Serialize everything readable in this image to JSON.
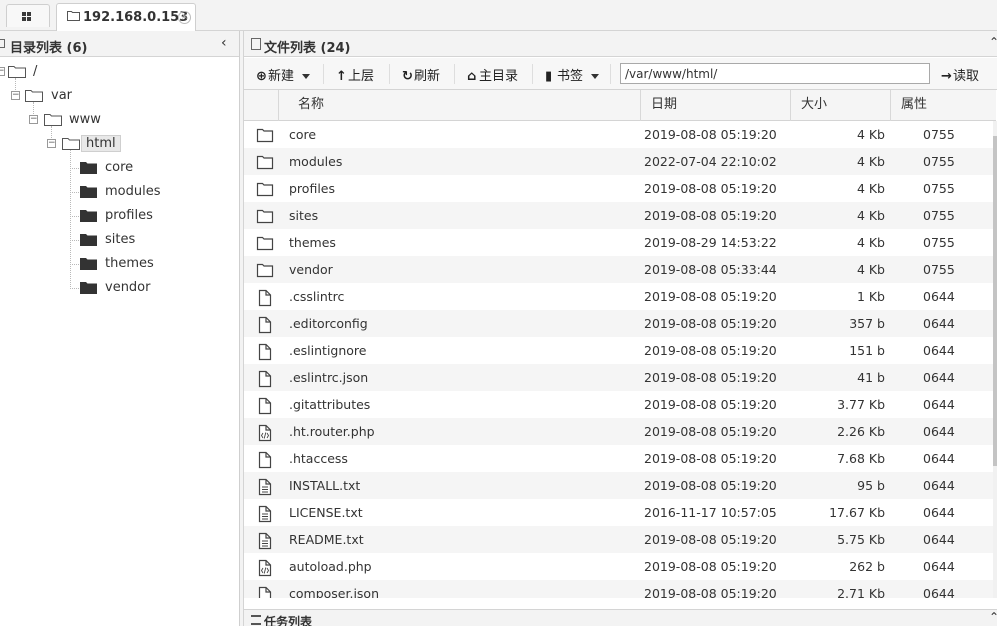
{
  "tabs": {
    "host_label": "192.168.0.153",
    "close_glyph": "⊗"
  },
  "tree": {
    "header": "目录列表 (6)",
    "root": "/",
    "var": "var",
    "www": "www",
    "html": "html",
    "children": [
      "core",
      "modules",
      "profiles",
      "sites",
      "themes",
      "vendor"
    ]
  },
  "files": {
    "header": "文件列表 (24)",
    "toolbar": {
      "new": "新建",
      "up": "上层",
      "refresh": "刷新",
      "home": "主目录",
      "bookmark": "书签",
      "path": "/var/www/html/",
      "read": "读取"
    },
    "columns": [
      "名称",
      "日期",
      "大小",
      "属性"
    ],
    "rows": [
      {
        "type": "folder",
        "name": "core",
        "date": "2019-08-08 05:19:20",
        "size": "4 Kb",
        "attr": "0755"
      },
      {
        "type": "folder",
        "name": "modules",
        "date": "2022-07-04 22:10:02",
        "size": "4 Kb",
        "attr": "0755"
      },
      {
        "type": "folder",
        "name": "profiles",
        "date": "2019-08-08 05:19:20",
        "size": "4 Kb",
        "attr": "0755"
      },
      {
        "type": "folder",
        "name": "sites",
        "date": "2019-08-08 05:19:20",
        "size": "4 Kb",
        "attr": "0755"
      },
      {
        "type": "folder",
        "name": "themes",
        "date": "2019-08-29 14:53:22",
        "size": "4 Kb",
        "attr": "0755"
      },
      {
        "type": "folder",
        "name": "vendor",
        "date": "2019-08-08 05:33:44",
        "size": "4 Kb",
        "attr": "0755"
      },
      {
        "type": "file",
        "name": ".csslintrc",
        "date": "2019-08-08 05:19:20",
        "size": "1 Kb",
        "attr": "0644"
      },
      {
        "type": "file",
        "name": ".editorconfig",
        "date": "2019-08-08 05:19:20",
        "size": "357 b",
        "attr": "0644"
      },
      {
        "type": "file",
        "name": ".eslintignore",
        "date": "2019-08-08 05:19:20",
        "size": "151 b",
        "attr": "0644"
      },
      {
        "type": "file",
        "name": ".eslintrc.json",
        "date": "2019-08-08 05:19:20",
        "size": "41 b",
        "attr": "0644"
      },
      {
        "type": "file",
        "name": ".gitattributes",
        "date": "2019-08-08 05:19:20",
        "size": "3.77 Kb",
        "attr": "0644"
      },
      {
        "type": "code",
        "name": ".ht.router.php",
        "date": "2019-08-08 05:19:20",
        "size": "2.26 Kb",
        "attr": "0644"
      },
      {
        "type": "file",
        "name": ".htaccess",
        "date": "2019-08-08 05:19:20",
        "size": "7.68 Kb",
        "attr": "0644"
      },
      {
        "type": "text",
        "name": "INSTALL.txt",
        "date": "2019-08-08 05:19:20",
        "size": "95 b",
        "attr": "0644"
      },
      {
        "type": "text",
        "name": "LICENSE.txt",
        "date": "2016-11-17 10:57:05",
        "size": "17.67 Kb",
        "attr": "0644"
      },
      {
        "type": "text",
        "name": "README.txt",
        "date": "2019-08-08 05:19:20",
        "size": "5.75 Kb",
        "attr": "0644"
      },
      {
        "type": "code",
        "name": "autoload.php",
        "date": "2019-08-08 05:19:20",
        "size": "262 b",
        "attr": "0644"
      },
      {
        "type": "file",
        "name": "composer.json",
        "date": "2019-08-08 05:19:20",
        "size": "2.71 Kb",
        "attr": "0644"
      }
    ]
  },
  "tasks": {
    "header": "任务列表"
  }
}
